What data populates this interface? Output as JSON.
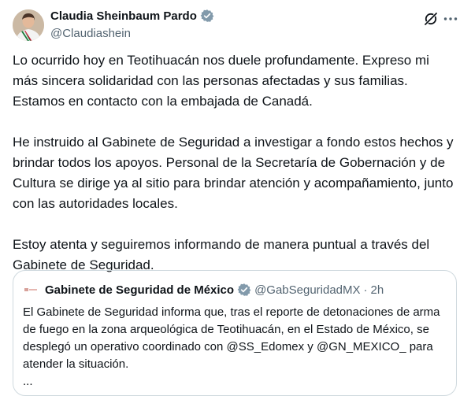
{
  "author": {
    "name": "Claudia Sheinbaum Pardo",
    "handle": "@Claudiashein",
    "avatar_icon": "profile-photo"
  },
  "header_icons": [
    "grok-icon",
    "more-options-icon"
  ],
  "tweet": {
    "paragraphs": [
      "Lo ocurrido hoy en Teotihuacán nos duele profundamente. Expreso mi más sincera solidaridad con las personas afectadas y sus familias. Estamos en contacto con la embajada de Canadá.",
      "He instruido al Gabinete de Seguridad a investigar a fondo estos hechos y brindar todos los apoyos. Personal de la Secretaría de Gobernación y de Cultura se dirige ya al sitio para brindar atención y acompañamiento, junto con las autoridades locales.",
      "Estoy atenta y seguiremos informando de manera puntual a través del Gabinete de Seguridad."
    ]
  },
  "quote": {
    "name": "Gabinete de Seguridad de México",
    "handle": "@GabSeguridadMX",
    "separator": "·",
    "time": "2h",
    "text": "El Gabinete de Seguridad informa que, tras el reporte de detonaciones de arma de fuego en la zona arqueológica de Teotihuacán, en el Estado de México, se desplegó un operativo coordinado con @SS_Edomex y @GN_MEXICO_ para atender la situación.",
    "ellipsis": "..."
  },
  "colors": {
    "text": "#0f1419",
    "secondary": "#536471",
    "verified_blue": "#1d9bf0",
    "verified_gray": "#829aab",
    "border": "#cfd9de"
  }
}
